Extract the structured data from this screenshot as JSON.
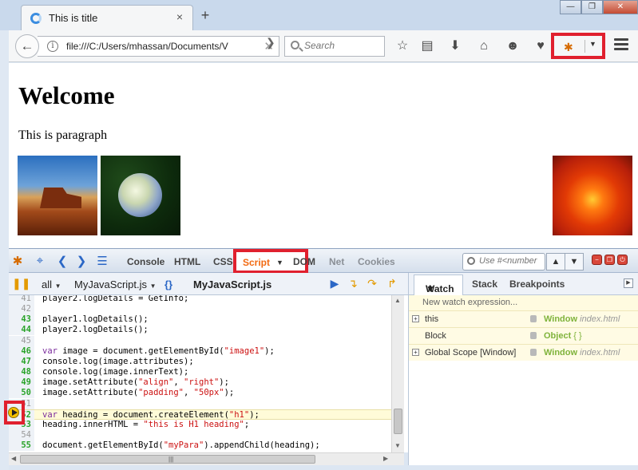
{
  "browser": {
    "tab_title": "This is title",
    "tab_close": "×",
    "new_tab": "+",
    "window_buttons": [
      "—",
      "❐",
      "✕"
    ],
    "url": "file:///C:/Users/mhassan/Documents/V",
    "search_placeholder": "Search",
    "toolbar_icons": [
      "star-icon",
      "reading-list-icon",
      "download-icon",
      "home-icon",
      "chat-icon",
      "pocket-icon",
      "firebug-icon",
      "menu-icon"
    ]
  },
  "page": {
    "heading": "Welcome",
    "paragraph": "This is paragraph"
  },
  "firebug": {
    "tabs": {
      "console": "Console",
      "html": "HTML",
      "css": "CSS",
      "script": "Script",
      "dom": "DOM",
      "net": "Net",
      "cookies": "Cookies"
    },
    "search_placeholder": "Use #<number",
    "script_toolbar": {
      "filter": "all",
      "file_selector": "MyJavaScript.js",
      "pretty_print": "{}",
      "current_file": "MyJavaScript.js"
    },
    "sidebar_tabs": {
      "watch": "Watch",
      "stack": "Stack",
      "breakpoints": "Breakpoints"
    },
    "source_lines": [
      {
        "n": "41",
        "exec": false,
        "code": "player2.logDetails = GetInfo;"
      },
      {
        "n": "42",
        "exec": false,
        "code": ""
      },
      {
        "n": "43",
        "exec": true,
        "code": "player1.logDetails();"
      },
      {
        "n": "44",
        "exec": true,
        "code": "player2.logDetails();"
      },
      {
        "n": "45",
        "exec": false,
        "code": ""
      },
      {
        "n": "46",
        "exec": true,
        "code": "var image = document.getElementById(\"image1\");"
      },
      {
        "n": "47",
        "exec": true,
        "code": "console.log(image.attributes);"
      },
      {
        "n": "48",
        "exec": true,
        "code": "console.log(image.innerText);"
      },
      {
        "n": "49",
        "exec": true,
        "code": "image.setAttribute(\"align\", \"right\");"
      },
      {
        "n": "50",
        "exec": true,
        "code": "image.setAttribute(\"padding\", \"50px\");"
      },
      {
        "n": "51",
        "exec": false,
        "code": ""
      },
      {
        "n": "52",
        "exec": true,
        "code": "var heading = document.createElement(\"h1\");"
      },
      {
        "n": "53",
        "exec": true,
        "code": "heading.innerHTML = \"this is H1 heading\";"
      },
      {
        "n": "54",
        "exec": false,
        "code": ""
      },
      {
        "n": "55",
        "exec": true,
        "code": "document.getElementById(\"myPara\").appendChild(heading);"
      }
    ],
    "current_line": "52",
    "watch": {
      "new_expression": "New watch expression...",
      "rows": [
        {
          "name": "this",
          "value": "Window",
          "detail": "index.html"
        },
        {
          "name": "Block",
          "value": "Object",
          "detail": "{  }"
        },
        {
          "name": "Global Scope [Window]",
          "value": "Window",
          "detail": "index.html"
        }
      ]
    }
  }
}
